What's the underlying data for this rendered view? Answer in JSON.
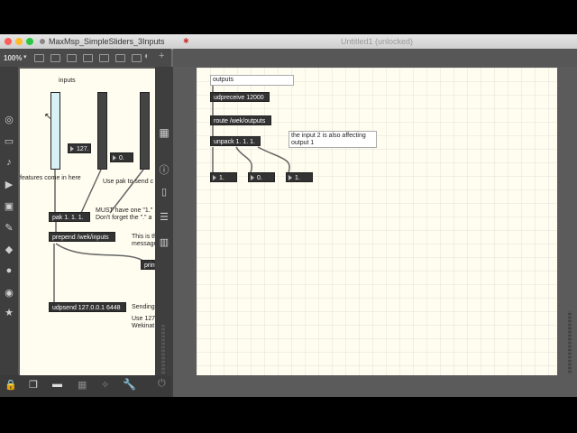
{
  "left_window": {
    "title": "MaxMsp_SimpleSliders_3Inputs",
    "zoom": "100%",
    "patch": {
      "label_inputs": "inputs",
      "number1": "127.",
      "number2": "0.",
      "comment_features": "features come in here",
      "comment_use_pak": "Use pak to send c",
      "pak_obj": "pak 1. 1. 1.",
      "comment_must1": "MUST have one \"1.\"",
      "comment_must2": "Don't forget the \".\" a",
      "prepend_obj": "prepend /wek/inputs",
      "comment_this1": "This is the O",
      "comment_this2": "message na",
      "print_obj": "print",
      "udpsend_obj": "udpsend 127.0.0.1 6448",
      "comment_sending": "Sending",
      "comment_use127": "Use 127",
      "comment_wekinat": "Wekinat"
    }
  },
  "right_window": {
    "title": "Untitled1 (unlocked)",
    "patch": {
      "message_outputs": "outputs",
      "udpreceive_obj": "udpreceive 12000",
      "route_obj": "route /wek/outputs",
      "unpack_obj": "unpack 1. 1. 1.",
      "comment_note1": "the input 2 is also affecting",
      "comment_note2": "output 1",
      "out1": "1.",
      "out2": "0.",
      "out3": "1."
    }
  },
  "colors": {
    "canvas": "#fffdf0",
    "object_bg": "#333333",
    "slider_fill": "#d7f1f7"
  }
}
